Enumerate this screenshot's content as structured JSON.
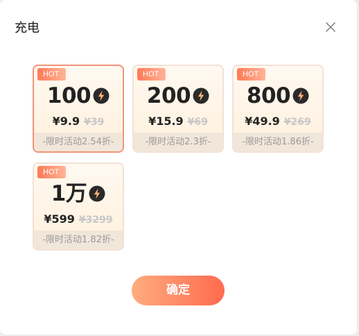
{
  "dialog": {
    "title": "充电",
    "confirm_label": "确定"
  },
  "packages": [
    {
      "badge": "HOT",
      "amount": "100",
      "price": "¥9.9",
      "original_price": "¥39",
      "promo": "-限时活动2.54折-",
      "selected": true
    },
    {
      "badge": "HOT",
      "amount": "200",
      "price": "¥15.9",
      "original_price": "¥69",
      "promo": "-限时活动2.3折-",
      "selected": false
    },
    {
      "badge": "HOT",
      "amount": "800",
      "price": "¥49.9",
      "original_price": "¥269",
      "promo": "-限时活动1.86折-",
      "selected": false
    },
    {
      "badge": "HOT",
      "amount": "1万",
      "price": "¥599",
      "original_price": "¥3299",
      "promo": "-限时活动1.82折-",
      "selected": false
    }
  ],
  "icons": {
    "close": "close-icon",
    "currency": "lightning-bolt-icon"
  },
  "colors": {
    "accent_start": "#ffac7e",
    "accent_end": "#ff6b4f",
    "selected_border": "#f29379",
    "hot_badge": "#ff7a55"
  }
}
